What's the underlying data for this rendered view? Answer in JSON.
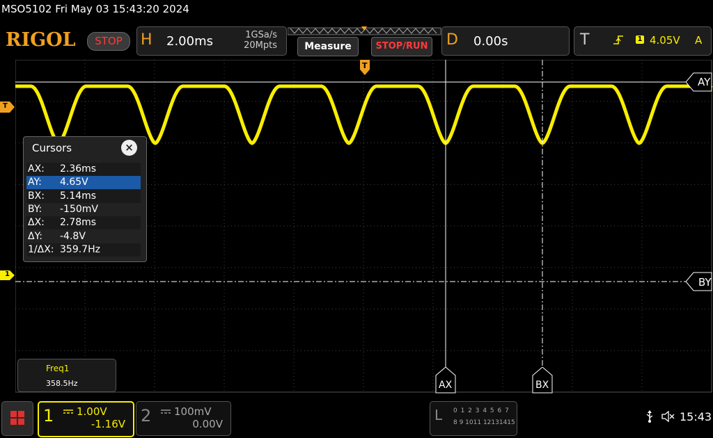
{
  "title_line": "MSO5102  Fri May 03 15:43:20 2024",
  "brand": "RIGOL",
  "run_state": "STOP",
  "horizontal": {
    "letter": "H",
    "timebase": "2.00ms",
    "sample_rate": "1GSa/s",
    "memory_depth": "20Mpts"
  },
  "buttons": {
    "measure": "Measure",
    "stop_run": "STOP/RUN"
  },
  "delay": {
    "letter": "D",
    "value": "0.00s"
  },
  "trigger": {
    "letter": "T",
    "source": "1",
    "level": "4.05V",
    "coupling": "A",
    "edge_icon": "rising-edge-icon"
  },
  "cursors": {
    "title": "Cursors",
    "close": "×",
    "rows": [
      {
        "key": "AX:",
        "value": "2.36ms"
      },
      {
        "key": "AY:",
        "value": "4.65V"
      },
      {
        "key": "BX:",
        "value": "5.14ms"
      },
      {
        "key": "BY:",
        "value": "-150mV"
      },
      {
        "key": "ΔX:",
        "value": "2.78ms"
      },
      {
        "key": "ΔY:",
        "value": "-4.8V"
      },
      {
        "key": "1/ΔX:",
        "value": "359.7Hz"
      }
    ],
    "selected_row": 1,
    "labels": {
      "ay": "AY",
      "by": "BY",
      "ax": "AX",
      "bx": "BX"
    }
  },
  "markers": {
    "trigger_level": "T",
    "ch1_ground": "1",
    "trigger_pos": "T"
  },
  "measurement": {
    "name": "Freq1",
    "value": "358.5Hz"
  },
  "channel1": {
    "number": "1",
    "scale": "1.00V",
    "offset": "-1.16V"
  },
  "channel2": {
    "number": "2",
    "scale": "100mV",
    "offset": "0.00V"
  },
  "logic": {
    "letter": "L",
    "row1": "0 1 2 3  4 5 6 7",
    "row2": "8 9 1011 12131415"
  },
  "status": {
    "time": "15:43"
  },
  "colors": {
    "ch1": "#f8ee00",
    "brand": "#f0a020",
    "stop": "#ff3a3a",
    "selected": "#1b5aa6",
    "grid": "#3a3a3a"
  }
}
